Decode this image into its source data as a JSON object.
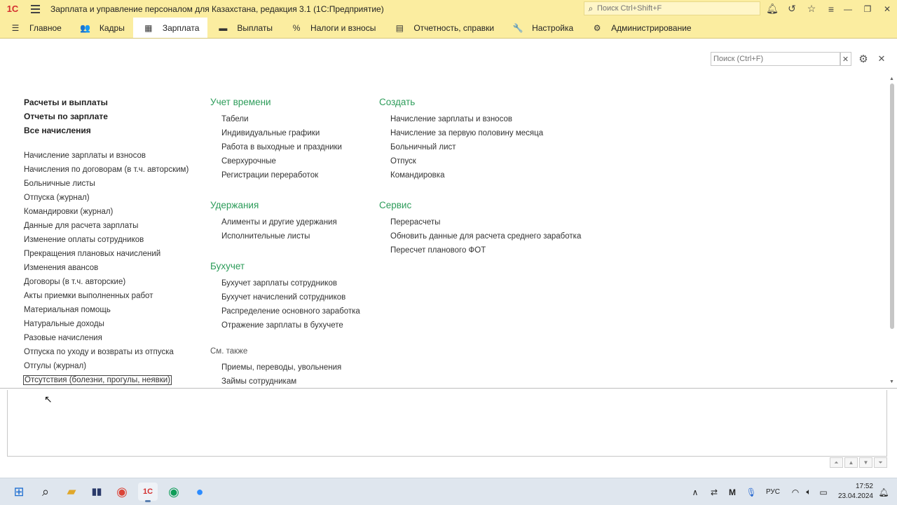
{
  "titlebar": {
    "logo": "1С",
    "title": "Зарплата и управление персоналом для Казахстана, редакция 3.1  (1С:Предприятие)",
    "search_placeholder": "Поиск Ctrl+Shift+F"
  },
  "sections": [
    {
      "label": "Главное",
      "icon": "hamburger-icon",
      "glyph": "☰",
      "active": false
    },
    {
      "label": "Кадры",
      "icon": "users-icon",
      "glyph": "👥",
      "active": false
    },
    {
      "label": "Зарплата",
      "icon": "calculator-icon",
      "glyph": "▦",
      "active": true
    },
    {
      "label": "Выплаты",
      "icon": "wallet-icon",
      "glyph": "▬",
      "active": false
    },
    {
      "label": "Налоги и взносы",
      "icon": "percent-icon",
      "glyph": "%",
      "active": false
    },
    {
      "label": "Отчетность, справки",
      "icon": "reports-icon",
      "glyph": "▤",
      "active": false
    },
    {
      "label": "Настройка",
      "icon": "wrench-icon",
      "glyph": "🔧",
      "active": false
    },
    {
      "label": "Администрирование",
      "icon": "gear-icon",
      "glyph": "⚙",
      "active": false
    }
  ],
  "panel": {
    "search_placeholder": "Поиск (Ctrl+F)",
    "col1": {
      "bold": [
        "Расчеты и выплаты",
        "Отчеты по зарплате",
        "Все начисления"
      ],
      "items": [
        "Начисление зарплаты и взносов",
        "Начисления по договорам (в т.ч. авторским)",
        "Больничные листы",
        "Отпуска (журнал)",
        "Командировки (журнал)",
        "Данные для расчета зарплаты",
        "Изменение оплаты сотрудников",
        "Прекращения плановых начислений",
        "Изменения авансов",
        "Договоры (в т.ч. авторские)",
        "Акты приемки выполненных работ",
        "Материальная помощь",
        "Натуральные доходы",
        "Разовые начисления",
        "Отпуска по уходу и возвраты из отпуска",
        "Отгулы (журнал)"
      ],
      "focused_item": "Отсутствия (болезни, прогулы, неявки)"
    },
    "col2": {
      "groups": [
        {
          "title": "Учет времени",
          "items": [
            "Табели",
            "Индивидуальные графики",
            "Работа в выходные и праздники",
            "Сверхурочные",
            "Регистрации переработок"
          ]
        },
        {
          "title": "Удержания",
          "items": [
            "Алименты и другие удержания",
            "Исполнительные листы"
          ]
        },
        {
          "title": "Бухучет",
          "items": [
            "Бухучет зарплаты сотрудников",
            "Бухучет начислений сотрудников",
            "Распределение основного заработка",
            "Отражение зарплаты в бухучете"
          ]
        }
      ],
      "see_also_title": "См. также",
      "see_also": [
        "Приемы, переводы, увольнения",
        "Займы сотрудникам"
      ]
    },
    "col3": {
      "groups": [
        {
          "title": "Создать",
          "items": [
            "Начисление зарплаты и взносов",
            "Начисление за первую половину месяца",
            "Больничный лист",
            "Отпуск",
            "Командировка"
          ]
        },
        {
          "title": "Сервис",
          "items": [
            "Перерасчеты",
            "Обновить данные для расчета среднего заработка",
            "Пересчет планового ФОТ"
          ]
        }
      ]
    }
  },
  "taskbar": {
    "language": "РУС",
    "time": "17:52",
    "date": "23.04.2024"
  }
}
